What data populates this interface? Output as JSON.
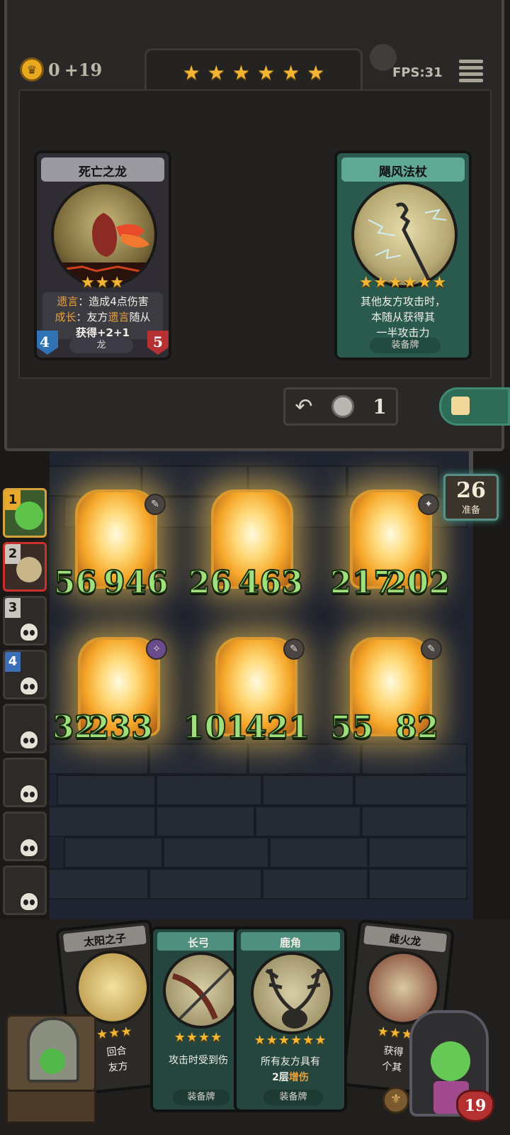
{
  "top_bar": {
    "gold_value": "0",
    "gold_increment": "+19",
    "fps": "FPS:31",
    "tier_stars": 6
  },
  "shop_cards": [
    {
      "title": "死亡之龙",
      "stars": 3,
      "text_line1_keyword": "遗言",
      "text_line1": "：造成4点伤害",
      "text_line2_keyword": "成长",
      "text_line2_a": "：友方",
      "text_line2_kw2": "遗言",
      "text_line2_b": "随从",
      "text_line3": "获得+2+1",
      "attack": "4",
      "health": "5",
      "tribe": "龙"
    },
    {
      "title": "飓风法杖",
      "stars": 6,
      "text_line1": "其他友方攻击时，",
      "text_line2": "本随从获得其",
      "text_line3": "一半攻击力",
      "tag": "装备牌"
    }
  ],
  "refresh": {
    "cost": "1"
  },
  "timer": {
    "value": "26",
    "label": "准备"
  },
  "opponents": [
    {
      "rank": "1",
      "color": "#e8a92c"
    },
    {
      "rank": "2",
      "color": "#c9c5be"
    },
    {
      "rank": "3",
      "color": "#c9c5be"
    },
    {
      "rank": "4",
      "color": "#3c6fb7"
    },
    {
      "rank": "",
      "color": ""
    },
    {
      "rank": "",
      "color": ""
    },
    {
      "rank": "",
      "color": ""
    },
    {
      "rank": "",
      "color": ""
    }
  ],
  "board_stats": {
    "row1": [
      "56",
      "946",
      "26",
      "463",
      "217",
      "202"
    ],
    "row2": [
      "32",
      "233",
      "101",
      "421",
      "55",
      "82"
    ]
  },
  "hand_cards": [
    {
      "title": "太阳之子",
      "text": "回合",
      "text2": "友方"
    },
    {
      "title": "长弓",
      "text": "攻击时受到伤",
      "tag": "装备牌"
    },
    {
      "title": "鹿角",
      "text": "所有友方具有",
      "text2_a": "2层",
      "text2_kw": "增伤",
      "tag": "装备牌"
    },
    {
      "title": "雌火龙",
      "text": "获得",
      "text2": "个其"
    }
  ],
  "player": {
    "health": "19"
  }
}
